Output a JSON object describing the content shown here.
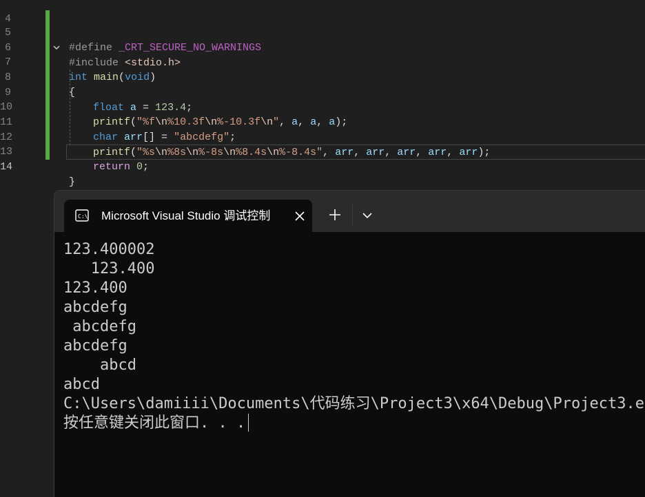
{
  "editor": {
    "lines": [
      {
        "n": "4"
      },
      {
        "n": "5",
        "t": [
          "#define ",
          "_CRT_SECURE_NO_WARNINGS"
        ]
      },
      {
        "n": "6",
        "t": [
          "#include ",
          "<stdio.h>"
        ]
      },
      {
        "n": "7",
        "t": [
          "int",
          " ",
          "main",
          "(",
          "void",
          ")"
        ]
      },
      {
        "n": "8",
        "t": [
          "{"
        ]
      },
      {
        "n": "9",
        "t": [
          "float",
          " ",
          "a",
          " = ",
          "123.4",
          ";"
        ]
      },
      {
        "n": "10",
        "t": [
          "printf",
          "(",
          "\"%f",
          "\\n",
          "%10.3f",
          "\\n",
          "%-10.3f",
          "\\n",
          "\"",
          ", ",
          "a",
          ", ",
          "a",
          ", ",
          "a",
          ");"
        ]
      },
      {
        "n": "11",
        "t": [
          "char",
          " ",
          "arr",
          "[] = ",
          "\"abcdefg\"",
          ";"
        ]
      },
      {
        "n": "12",
        "t": [
          "printf",
          "(",
          "\"%s",
          "\\n",
          "%8s",
          "\\n",
          "%-8s",
          "\\n",
          "%8.4s",
          "\\n",
          "%-8.4s\"",
          ", ",
          "arr",
          ", ",
          "arr",
          ", ",
          "arr",
          ", ",
          "arr",
          ", ",
          "arr",
          ");"
        ]
      },
      {
        "n": "13",
        "t": [
          "return",
          " ",
          "0",
          ";"
        ]
      },
      {
        "n": "14",
        "t": [
          "}"
        ]
      }
    ]
  },
  "console": {
    "tab_title": "Microsoft Visual Studio 调试控制台",
    "output": [
      "123.400002",
      "   123.400",
      "123.400",
      "abcdefg",
      " abcdefg",
      "abcdefg",
      "    abcd",
      "abcd",
      "C:\\Users\\damiiii\\Documents\\代码练习\\Project3\\x64\\Debug\\Project3.exe",
      "按任意键关闭此窗口. . ."
    ]
  },
  "colors": {
    "editor_bg": "#1f1f1f",
    "console_bg": "#0c0c0c",
    "titlebar_bg": "#2b2b2b",
    "change_bar": "#57a64a",
    "keyword": "#569cd6",
    "function": "#dcdcaa",
    "variable": "#9cdcfe",
    "string": "#d69d85",
    "number": "#b5cea8",
    "macro": "#bd63c5"
  },
  "icons": {
    "tab_icon": "console-icon",
    "tab_close": "close-icon",
    "new_tab": "plus-icon",
    "tab_menu": "chevron-down-icon",
    "fold": "chevron-down-icon"
  }
}
